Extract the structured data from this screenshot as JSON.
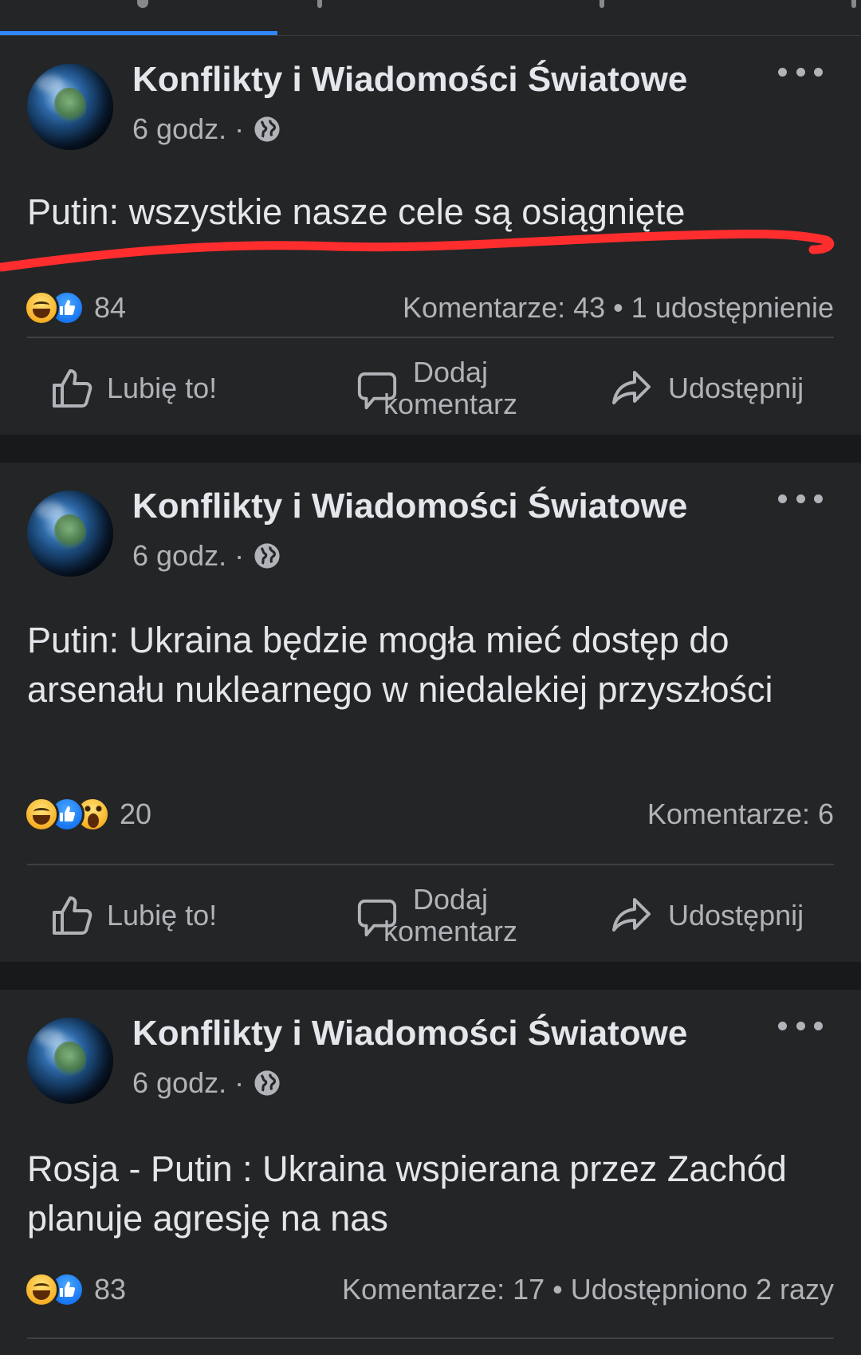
{
  "tabs": {
    "active_index": 0
  },
  "posts": [
    {
      "page_name": "Konflikty i Wiadomości Światowe",
      "time": "6 godz.",
      "separator": "·",
      "text": "Putin: wszystkie nasze cele są osiągnięte",
      "reaction_count": "84",
      "reactions": [
        "haha",
        "like"
      ],
      "comments_shares": "Komentarze: 43 • 1 udostępnienie"
    },
    {
      "page_name": "Konflikty i Wiadomości Światowe",
      "time": "6 godz.",
      "separator": "·",
      "text": "Putin: Ukraina będzie mogła mieć dostęp do arsenału nuklearnego w niedalekiej przyszłości",
      "reaction_count": "20",
      "reactions": [
        "haha",
        "like",
        "wow"
      ],
      "comments_shares": "Komentarze: 6"
    },
    {
      "page_name": "Konflikty i Wiadomości Światowe",
      "time": "6 godz.",
      "separator": "·",
      "text": "Rosja - Putin : Ukraina wspierana przez Zachód planuje agresję na nas",
      "reaction_count": "83",
      "reactions": [
        "haha",
        "like"
      ],
      "comments_shares": "Komentarze: 17 • Udostępniono 2 razy"
    }
  ],
  "actions": {
    "like_label": "Lubię to!",
    "comment_label": "Dodaj komentarz",
    "share_label": "Udostępnij"
  },
  "colors": {
    "background": "#18191a",
    "card": "#242526",
    "text_primary": "#e4e6eb",
    "text_secondary": "#b0b3b8",
    "accent_blue": "#2d88ff",
    "annotation_red": "#ff2d2d"
  },
  "icons": {
    "globe": "globe-icon",
    "more": "more-options-icon",
    "like": "thumbs-up-icon",
    "comment": "comment-bubble-icon",
    "share": "share-arrow-icon"
  }
}
